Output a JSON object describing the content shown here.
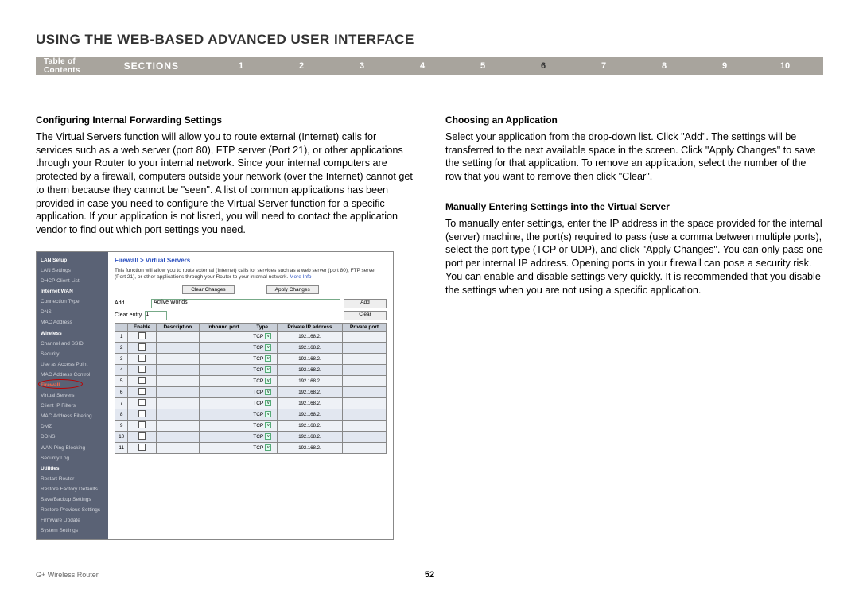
{
  "page_title": "USING THE WEB-BASED ADVANCED USER INTERFACE",
  "nav": {
    "toc": "Table of Contents",
    "sections": "SECTIONS",
    "numbers": [
      "1",
      "2",
      "3",
      "4",
      "5",
      "6",
      "7",
      "8",
      "9",
      "10"
    ],
    "current": "6"
  },
  "left": {
    "heading": "Configuring Internal Forwarding Settings",
    "para": "The Virtual Servers function will allow you to route external (Internet) calls for services such as a web server (port 80), FTP server (Port 21), or other applications through your Router to your internal network. Since your internal computers are protected by a firewall, computers outside your network (over the Internet) cannot get to them because they cannot be \"seen\". A list of common applications has been provided in case you need to configure the Virtual Server function for a specific application. If your application is not listed, you will need to contact the application vendor to find out which port settings you need."
  },
  "right": {
    "h1": "Choosing an Application",
    "p1": "Select your application from the drop-down list. Click \"Add\". The settings will be transferred to the next available space in the screen. Click \"Apply Changes\" to save the setting for that application. To remove an application, select the number of the row that you want to remove then click \"Clear\".",
    "h2": "Manually Entering Settings into the Virtual Server",
    "p2": "To manually enter settings, enter the IP address in the space provided for the internal (server) machine, the port(s) required to pass (use a comma between multiple ports), select the port type (TCP or UDP), and click \"Apply Changes\". You can only pass one port per internal IP address. Opening ports in your firewall can pose a security risk. You can enable and disable settings very quickly. It is recommended that you disable the settings when you are not using a specific application."
  },
  "router": {
    "sidebar": [
      {
        "text": "LAN Setup",
        "cls": "rs-head"
      },
      {
        "text": "LAN Settings"
      },
      {
        "text": "DHCP Client List"
      },
      {
        "text": "Internet WAN",
        "cls": "rs-head"
      },
      {
        "text": "Connection Type"
      },
      {
        "text": "DNS"
      },
      {
        "text": "MAC Address"
      },
      {
        "text": "Wireless",
        "cls": "rs-head"
      },
      {
        "text": "Channel and SSID"
      },
      {
        "text": "Security"
      },
      {
        "text": "Use as Access Point"
      },
      {
        "text": "MAC Address Control"
      },
      {
        "text": "Firewall",
        "cls": "rs-head rs-active",
        "ring": true
      },
      {
        "text": "Virtual Servers"
      },
      {
        "text": "Client IP Filters"
      },
      {
        "text": "MAC Address Filtering"
      },
      {
        "text": "DMZ"
      },
      {
        "text": "DDNS"
      },
      {
        "text": "WAN Ping Blocking"
      },
      {
        "text": "Security Log"
      },
      {
        "text": "Utilities",
        "cls": "rs-head"
      },
      {
        "text": "Restart Router"
      },
      {
        "text": "Restore Factory Defaults"
      },
      {
        "text": "Save/Backup Settings"
      },
      {
        "text": "Restore Previous Settings"
      },
      {
        "text": "Firmware Update"
      },
      {
        "text": "System Settings"
      }
    ],
    "crumb": "Firewall > Virtual Servers",
    "desc": "This function will allow you to route external (Internet) calls for services such as a web server (port 80), FTP server (Port 21), or other applications through your Router to your internal network. ",
    "more": "More Info",
    "clear_changes": "Clear Changes",
    "apply_changes": "Apply Changes",
    "add_label": "Add",
    "add_value": "Active Worlds",
    "add_btn": "Add",
    "clear_entry_label": "Clear entry",
    "clear_entry_val": "1",
    "clear_btn": "Clear",
    "headers": [
      "",
      "Enable",
      "Description",
      "Inbound port",
      "Type",
      "Private IP address",
      "Private port"
    ],
    "rows": [
      {
        "n": "1",
        "type": "TCP",
        "ip": "192.168.2."
      },
      {
        "n": "2",
        "type": "TCP",
        "ip": "192.168.2."
      },
      {
        "n": "3",
        "type": "TCP",
        "ip": "192.168.2."
      },
      {
        "n": "4",
        "type": "TCP",
        "ip": "192.168.2."
      },
      {
        "n": "5",
        "type": "TCP",
        "ip": "192.168.2."
      },
      {
        "n": "6",
        "type": "TCP",
        "ip": "192.168.2."
      },
      {
        "n": "7",
        "type": "TCP",
        "ip": "192.168.2."
      },
      {
        "n": "8",
        "type": "TCP",
        "ip": "192.168.2."
      },
      {
        "n": "9",
        "type": "TCP",
        "ip": "192.168.2."
      },
      {
        "n": "10",
        "type": "TCP",
        "ip": "192.168.2."
      },
      {
        "n": "11",
        "type": "TCP",
        "ip": "192.168.2."
      }
    ]
  },
  "footer": {
    "product": "G+ Wireless Router",
    "page": "52"
  }
}
